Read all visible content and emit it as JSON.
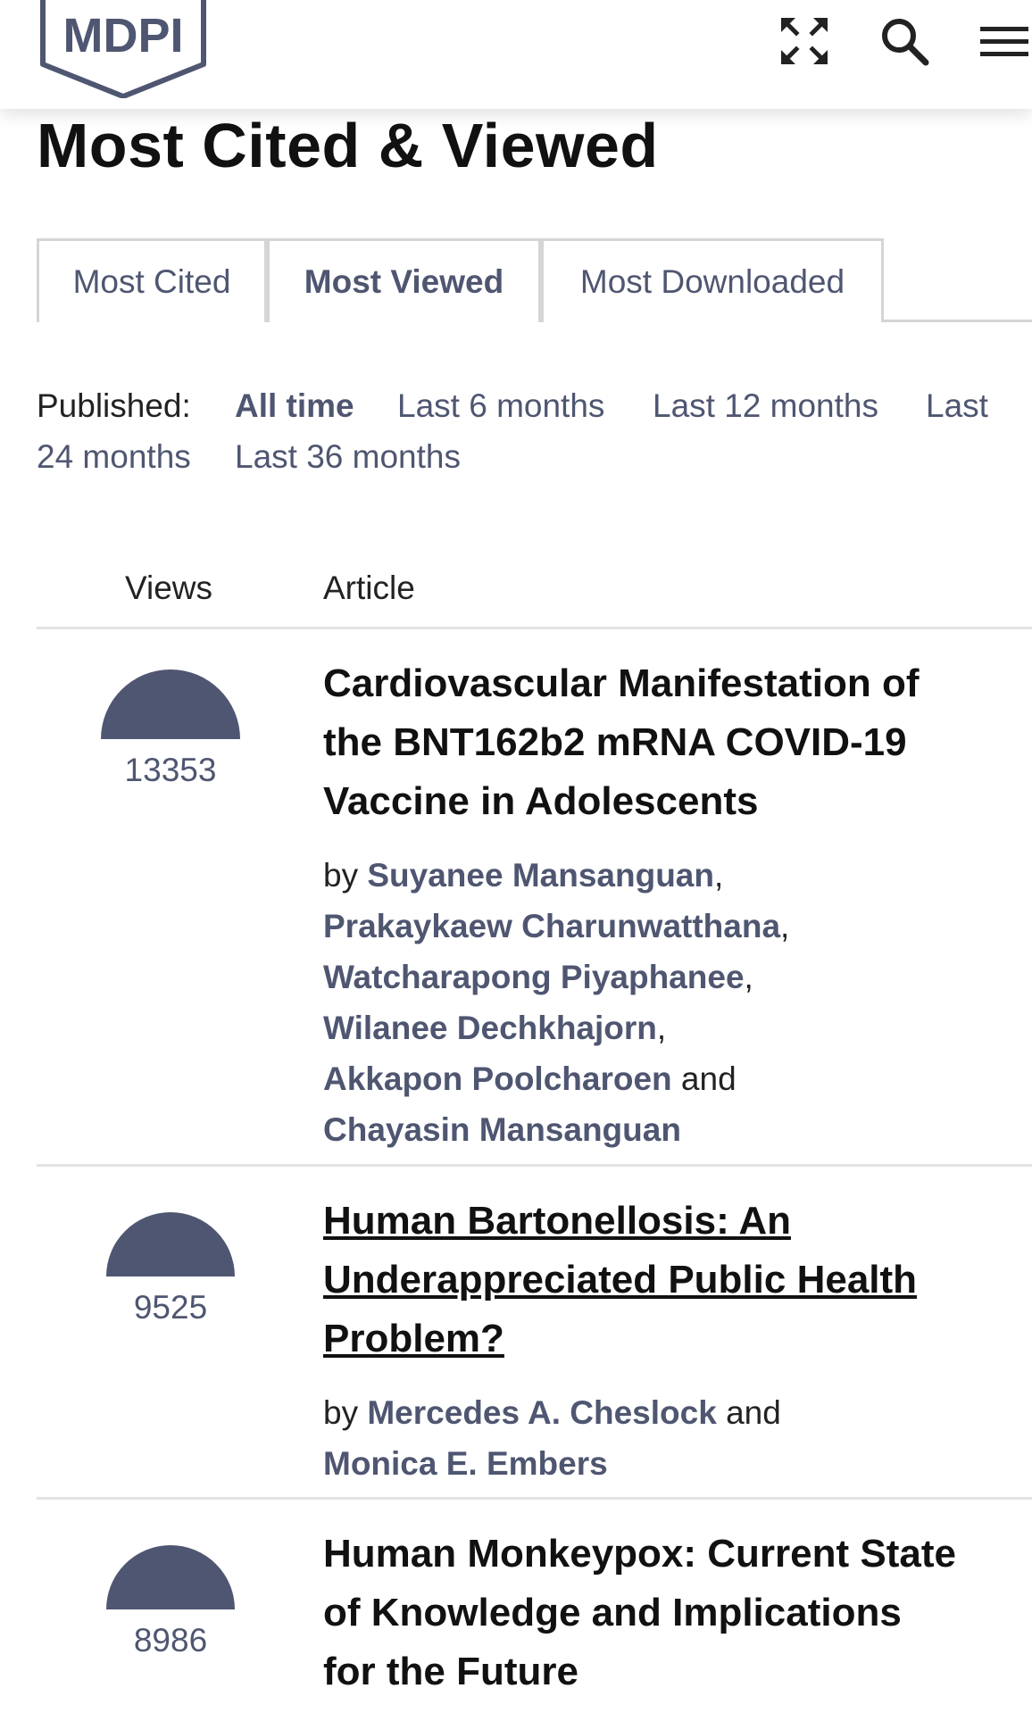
{
  "header": {
    "logo_text": "MDPI",
    "icons": [
      "expand-icon",
      "search-icon",
      "menu-icon"
    ]
  },
  "page": {
    "title": "Most Cited & Viewed"
  },
  "tabs": [
    {
      "label": "Most Cited",
      "active": false
    },
    {
      "label": "Most Viewed",
      "active": true
    },
    {
      "label": "Most Downloaded",
      "active": false
    }
  ],
  "filters": {
    "label": "Published:",
    "options": [
      {
        "label": "All time",
        "active": true
      },
      {
        "label": "Last 6 months",
        "active": false
      },
      {
        "label": "Last 12 months",
        "active": false
      },
      {
        "label": "Last 24 months",
        "active": false
      },
      {
        "label": "Last 36 months",
        "active": false
      }
    ],
    "option_4_line1": "Last",
    "option_4_line2": "24 months"
  },
  "table": {
    "col_views": "Views",
    "col_article": "Article"
  },
  "articles": [
    {
      "views": "13353",
      "title_lines": [
        "Cardiovascular Manifestation of",
        "the BNT162b2 mRNA COVID-19",
        "Vaccine in Adolescents"
      ],
      "by": "by",
      "and": "and",
      "authors": [
        "Suyanee Mansanguan",
        "Prakaykaew Charunwatthana",
        "Watcharapong Piyaphanee",
        "Wilanee Dechkhajorn",
        "Akkapon Poolcharoen",
        "Chayasin Mansanguan"
      ]
    },
    {
      "views": "9525",
      "title_lines": [
        "Human Bartonellosis: An",
        "Underappreciated Public Health",
        "Problem?"
      ],
      "by": "by",
      "and": "and",
      "authors": [
        "Mercedes A. Cheslock",
        "Monica E. Embers"
      ]
    },
    {
      "views": "8986",
      "title_lines": [
        "Human Monkeypox: Current State",
        "of Knowledge and Implications",
        "for the Future"
      ]
    }
  ],
  "colors": {
    "accent": "#4f5671",
    "text": "#222222",
    "border": "#d5d5d5"
  }
}
